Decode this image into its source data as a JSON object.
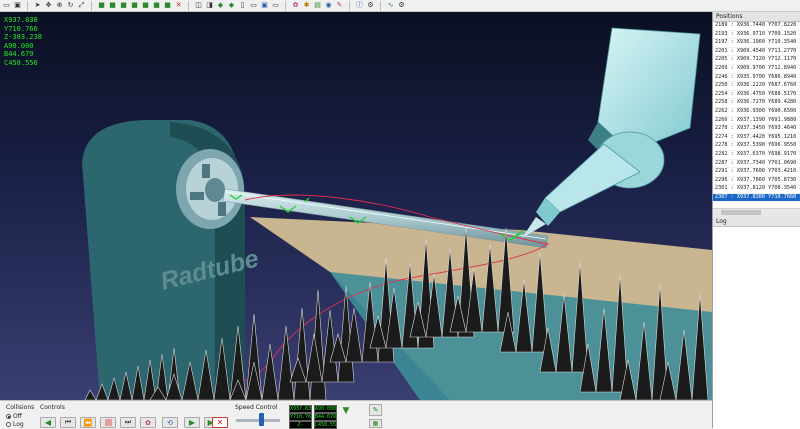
{
  "toolbar": {
    "buttons": [
      "open-file",
      "save-file",
      "pointer",
      "pan",
      "zoom",
      "rotate",
      "fit-view",
      "view-front",
      "view-back",
      "view-left",
      "view-right",
      "view-top",
      "view-bottom",
      "view-iso",
      "delete",
      "view-a",
      "view-b",
      "view-c",
      "view-d",
      "cylinder",
      "toggle-a",
      "toggle-b",
      "toggle-c",
      "robot",
      "settings",
      "layers",
      "group",
      "tool",
      "info",
      "rotate-part",
      "graph",
      "settings-2"
    ]
  },
  "viewport": {
    "coords": [
      "X937.838",
      "Y710.766",
      "Z-383.238",
      "A90.000",
      "B44.679",
      "C458.556"
    ],
    "brand_text": "Radtube",
    "colors": {
      "background_top": "#0a0f22",
      "background_bottom": "#3a3f72",
      "housing": "#2f6b72",
      "tube": "#a9c9cf",
      "robot": "#a5e0e4",
      "toolpath": "#e0304a",
      "markers": "#21d12d"
    }
  },
  "positions": {
    "title": "Positions",
    "rows": [
      "2189 : X936.7440 Y707.8220 Z-38",
      "2193 : X936.9710 Y709.1520 Z-38",
      "2197 : X936.1960 Y710.3540 Z-38",
      "2201 : X909.4540 Y711.2770 Z-38",
      "2205 : X909.7120 Y712.1170 Z-38",
      "2209 : X909.9700 Y712.8940 Z-38",
      "2246 : X935.9700 Y686.8940 Z-38",
      "2250 : X936.2220 Y687.6760 Z-38",
      "2254 : X936.4750 Y688.5170 Z-38",
      "2258 : X936.7270 Y689.4280 Z-38",
      "2262 : X936.9300 Y690.6500 Z-38",
      "2266 : X937.1390 Y691.9880 Z-38",
      "2270 : X937.3450 Y693.4640 Z-38",
      "2274 : X937.4420 Y695.1210 Z-38",
      "2278 : X937.5390 Y696.9550 Z-37",
      "2282 : X937.6370 Y698.9170 Z-37",
      "2287 : X937.7340 Y701.0690 Z-37",
      "2291 : X937.7600 Y703.4210 Z-38",
      "2296 : X937.7860 Y705.8730 Z-38",
      "2301 : X937.8120 Y708.3540 Z-38",
      "2307 : X937.8380 Y710.7660 Z-38"
    ],
    "selected_index": 20
  },
  "log": {
    "title": "Log"
  },
  "bottom": {
    "collisions_label": "Collisions",
    "off_label": "Off",
    "log_label": "Log",
    "collisions_value": "Off",
    "controls_label": "Controls",
    "speed_label": "Speed Control",
    "speed_level": 0.6,
    "buttons": [
      "step-back",
      "rewind",
      "skip-start",
      "stop",
      "skip-end",
      "camera-follow",
      "loop-path",
      "play",
      "step-forward",
      "close"
    ],
    "readouts": [
      "X937.838",
      "Y710.766",
      "Z-383.238",
      "A90.000",
      "B44.679",
      "C458.556"
    ]
  }
}
